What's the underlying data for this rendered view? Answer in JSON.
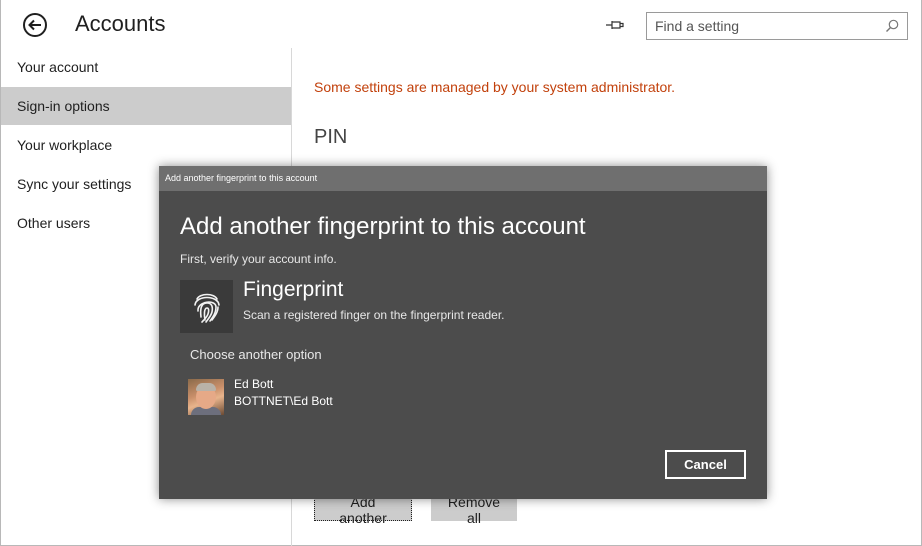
{
  "header": {
    "title": "Accounts",
    "search_placeholder": "Find a setting"
  },
  "sidebar": {
    "items": [
      {
        "label": "Your account"
      },
      {
        "label": "Sign-in options",
        "selected": true
      },
      {
        "label": "Your workplace"
      },
      {
        "label": "Sync your settings"
      },
      {
        "label": "Other users"
      }
    ]
  },
  "main": {
    "notice": "Some settings are managed by your system administrator.",
    "section_title": "PIN",
    "add_another_label": "Add another",
    "remove_all_label": "Remove all"
  },
  "dialog": {
    "titlebar": "Add another fingerprint to this account",
    "heading": "Add another fingerprint to this account",
    "subtitle": "First, verify your account info.",
    "option": {
      "label": "Fingerprint",
      "description": "Scan a registered finger on the fingerprint reader.",
      "icon": "fingerprint-icon"
    },
    "choose_label": "Choose another option",
    "account": {
      "name": "Ed Bott",
      "id": "BOTTNET\\Ed Bott"
    },
    "cancel_label": "Cancel"
  },
  "colors": {
    "notice": "#c2410c",
    "dialog_bg": "#4c4c4c",
    "dialog_titlebar": "#6f6f6f",
    "selected_item": "#cccccc"
  }
}
